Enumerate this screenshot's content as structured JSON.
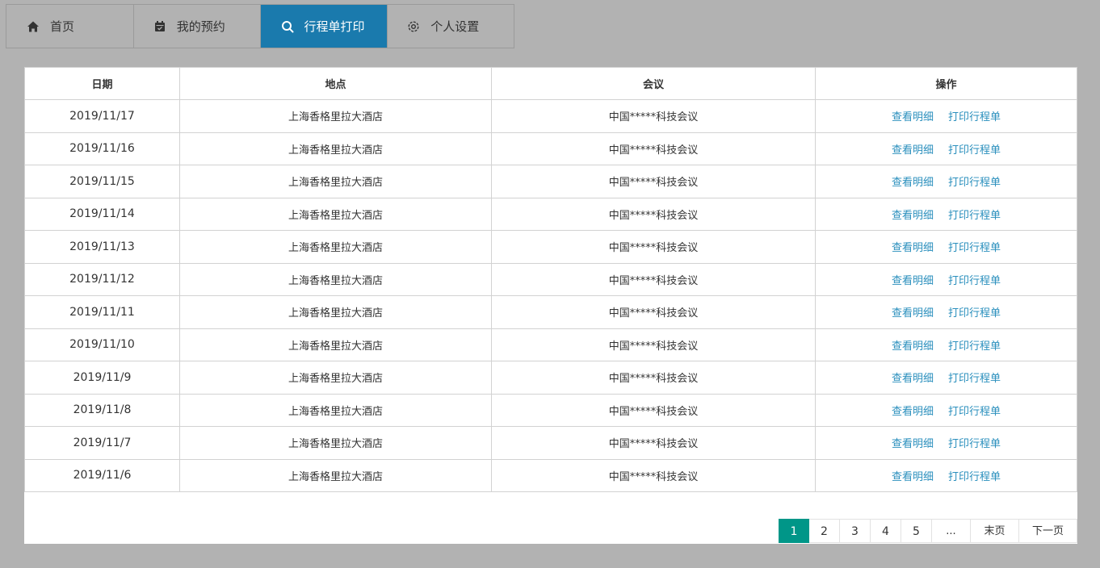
{
  "tabs": {
    "home": {
      "label": "首页",
      "icon": "home-icon"
    },
    "booking": {
      "label": "我的预约",
      "icon": "calendar-icon"
    },
    "print": {
      "label": "行程单打印",
      "icon": "search-icon",
      "active": true
    },
    "settings": {
      "label": "个人设置",
      "icon": "gear-icon"
    }
  },
  "table": {
    "headers": {
      "date": "日期",
      "location": "地点",
      "meeting": "会议",
      "actions": "操作"
    },
    "action_labels": {
      "view": "查看明细",
      "print": "打印行程单"
    },
    "rows": [
      {
        "date": "2019/11/17",
        "location": "上海香格里拉大酒店",
        "meeting": "中国*****科技会议"
      },
      {
        "date": "2019/11/16",
        "location": "上海香格里拉大酒店",
        "meeting": "中国*****科技会议"
      },
      {
        "date": "2019/11/15",
        "location": "上海香格里拉大酒店",
        "meeting": "中国*****科技会议"
      },
      {
        "date": "2019/11/14",
        "location": "上海香格里拉大酒店",
        "meeting": "中国*****科技会议"
      },
      {
        "date": "2019/11/13",
        "location": "上海香格里拉大酒店",
        "meeting": "中国*****科技会议"
      },
      {
        "date": "2019/11/12",
        "location": "上海香格里拉大酒店",
        "meeting": "中国*****科技会议"
      },
      {
        "date": "2019/11/11",
        "location": "上海香格里拉大酒店",
        "meeting": "中国*****科技会议"
      },
      {
        "date": "2019/11/10",
        "location": "上海香格里拉大酒店",
        "meeting": "中国*****科技会议"
      },
      {
        "date": "2019/11/9",
        "location": "上海香格里拉大酒店",
        "meeting": "中国*****科技会议"
      },
      {
        "date": "2019/11/8",
        "location": "上海香格里拉大酒店",
        "meeting": "中国*****科技会议"
      },
      {
        "date": "2019/11/7",
        "location": "上海香格里拉大酒店",
        "meeting": "中国*****科技会议"
      },
      {
        "date": "2019/11/6",
        "location": "上海香格里拉大酒店",
        "meeting": "中国*****科技会议"
      }
    ]
  },
  "pagination": {
    "pages": [
      "1",
      "2",
      "3",
      "4",
      "5"
    ],
    "current": "1",
    "ellipsis": "...",
    "last_label": "末页",
    "next_label": "下一页"
  },
  "colors": {
    "tab_active": "#1a7aad",
    "link": "#2a8fbd",
    "page_current": "#009688",
    "background": "#b2b2b2"
  }
}
